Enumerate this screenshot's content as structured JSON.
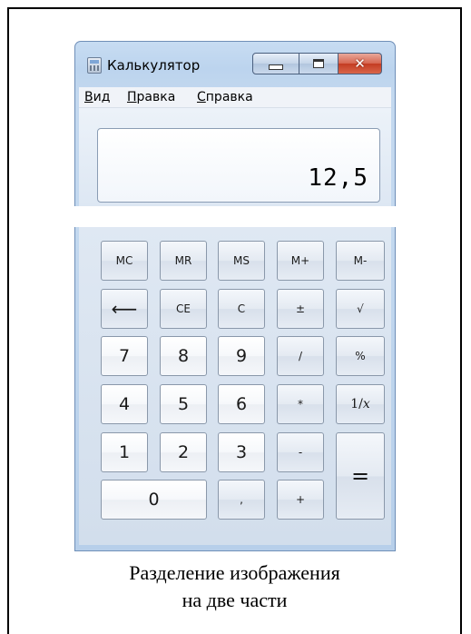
{
  "window": {
    "title": "Калькулятор",
    "close_glyph": "✕"
  },
  "menu": {
    "items": [
      {
        "label": "Вид",
        "accel": "В",
        "rest": "ид"
      },
      {
        "label": "Правка",
        "accel": "П",
        "rest": "равка"
      },
      {
        "label": "Справка",
        "accel": "С",
        "rest": "правка"
      }
    ]
  },
  "display": {
    "value": "12,5"
  },
  "keys": {
    "mc": "MC",
    "mr": "MR",
    "ms": "MS",
    "mplus": "M+",
    "mminus": "M-",
    "backspace": "⟵",
    "ce": "CE",
    "c": "C",
    "plusminus": "±",
    "sqrt": "√",
    "d7": "7",
    "d8": "8",
    "d9": "9",
    "divide": "/",
    "percent": "%",
    "d4": "4",
    "d5": "5",
    "d6": "6",
    "multiply": "*",
    "reciprocal": "1/x",
    "d1": "1",
    "d2": "2",
    "d3": "3",
    "minus": "-",
    "equals": "=",
    "d0": "0",
    "comma": ",",
    "plus": "+"
  },
  "caption": {
    "line1": "Разделение изображения",
    "line2": "на две части"
  },
  "colors": {
    "window_frame": "#c3d8ef",
    "close_button": "#c43c22",
    "display_bg": "#ffffff"
  }
}
